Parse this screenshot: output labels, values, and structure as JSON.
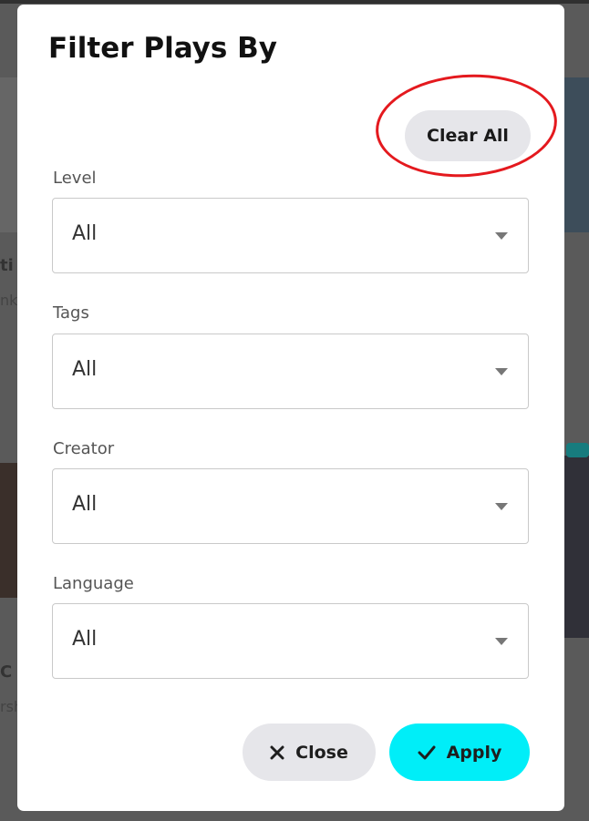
{
  "background": {
    "fragment_1": "ti",
    "fragment_2": "C",
    "fragment_3": "nk",
    "fragment_4": "rsh"
  },
  "modal": {
    "title": "Filter Plays By",
    "clear_all_label": "Clear All",
    "fields": [
      {
        "label": "Level",
        "value": "All"
      },
      {
        "label": "Tags",
        "value": "All"
      },
      {
        "label": "Creator",
        "value": "All"
      },
      {
        "label": "Language",
        "value": "All"
      }
    ],
    "close_label": "Close",
    "apply_label": "Apply"
  },
  "colors": {
    "apply_accent": "#00eef8",
    "annotation_circle": "#e4191e",
    "secondary_button": "#e6e6ea",
    "backdrop": "#5a5a5a"
  },
  "icons": {
    "close": "x-icon",
    "apply": "check-icon",
    "select": "caret-down-icon"
  }
}
